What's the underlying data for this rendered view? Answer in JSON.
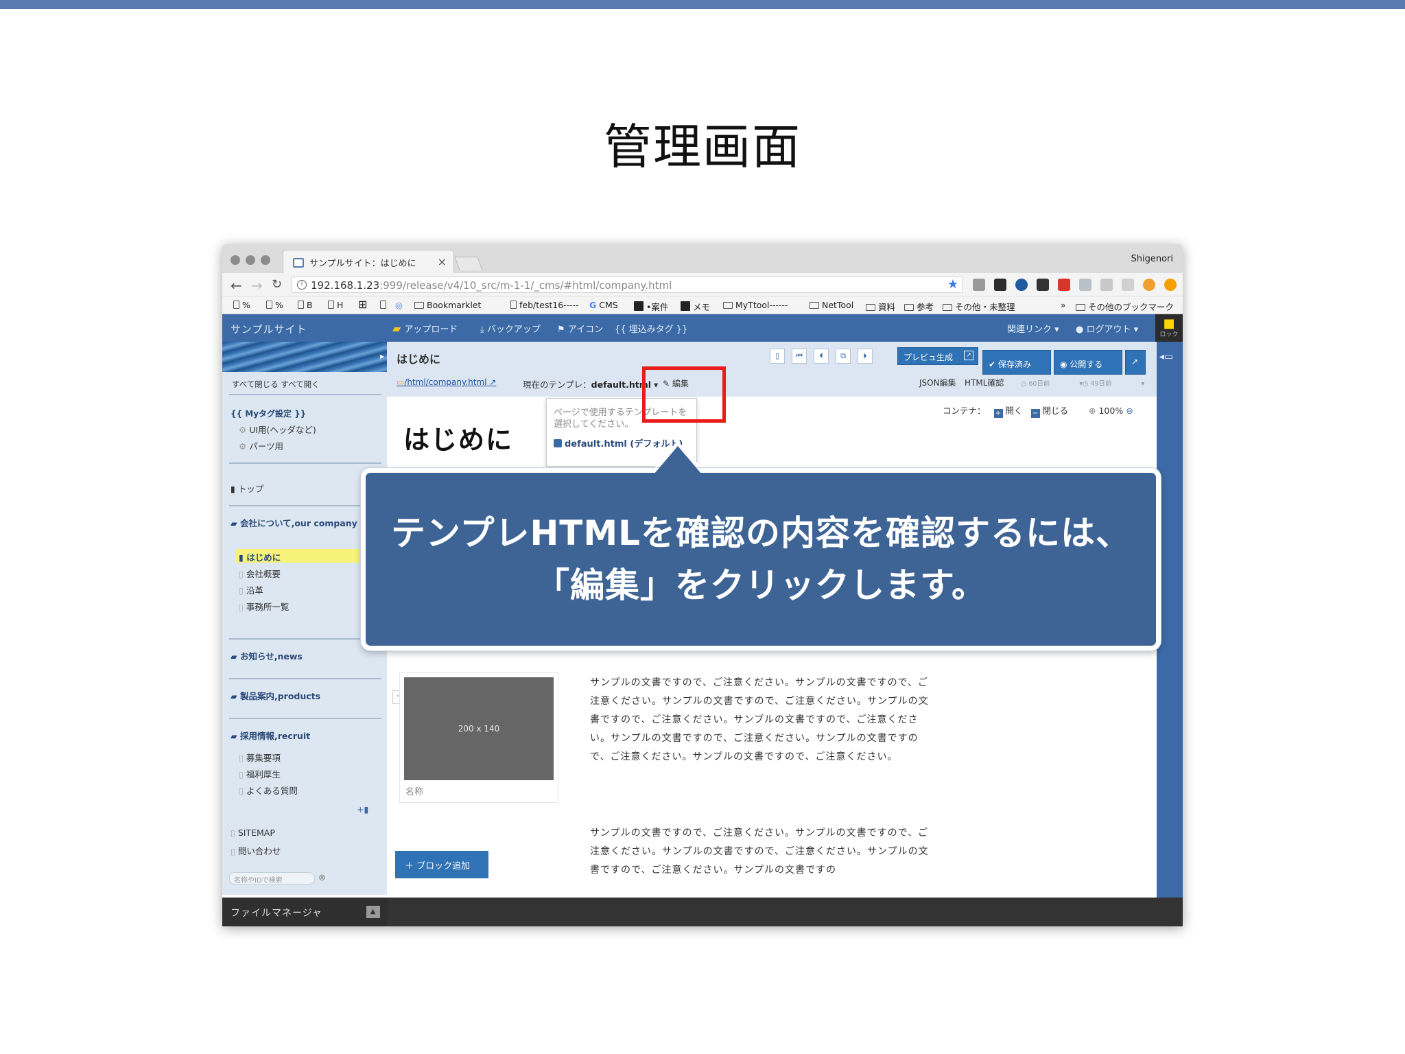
{
  "slide": {
    "title": "管理画面"
  },
  "browser": {
    "tab_title": "サンプルサイト：はじめに",
    "profile": "Shigenori",
    "url_host": "192.168.1.23",
    "url_rest": ":999/release/v4/10_src/m-1-1/_cms/#html/company.html",
    "bookmarks": [
      "%",
      "%",
      "B",
      "H",
      "Bookmarklet",
      "feb/test16-----",
      "CMS",
      "•案件",
      "メモ",
      "MyTtool------",
      "NetTool",
      "資料",
      "参考",
      "その他・未整理",
      "その他のブックマーク"
    ]
  },
  "cms": {
    "site_name": "サンプルサイト",
    "menu": {
      "upload": "アップロード",
      "backup": "バックアップ",
      "icon": "アイコン",
      "embed": "{{ 埋込みタグ }}",
      "related": "関連リンク ▾",
      "logout": "ログアウト ▾"
    },
    "lock_label": "ロック",
    "sidebar": {
      "toggle": "すべて閉じる  すべて開く",
      "mytag": "{{ Myタグ設定 }}",
      "ui": "UI用(ヘッダなど)",
      "parts": "パーツ用",
      "top": "トップ",
      "company": "会社について,our company",
      "intro": "はじめに",
      "overview": "会社概要",
      "history": "沿革",
      "offices": "事務所一覧",
      "news": "お知らせ,news",
      "products": "製品案内,products",
      "recruit": "採用情報,recruit",
      "jobs": "募集要項",
      "welfare": "福利厚生",
      "faq": "よくある質問",
      "sitemap": "SITEMAP",
      "contact": "問い合わせ",
      "search_placeholder": "名称やIDで検索",
      "file_manager": "ファイルマネージャ"
    },
    "page_title": "はじめに",
    "path": "/html/company.html",
    "template_label": "現在のテンプレ：",
    "template_name": "default.html",
    "edit": "編集",
    "preview_btn": "プレビュ生成",
    "saved_btn": "保存済み",
    "publish_btn": "公開する",
    "json_edit": "JSON編集",
    "html_check": "HTML確認",
    "time1": "60日前",
    "time2": "49日前",
    "container": "コンテナ：",
    "open": "開く",
    "close": "閉じる",
    "zoom": "100%",
    "content_heading": "はじめに",
    "popup_text": "ページで使用するテンプレートを選択してください。",
    "popup_option": "default.html (デフォルト)",
    "image_placeholder": "200 x 140",
    "image_caption": "名称",
    "paragraph1": "サンプルの文書ですので、ご注意ください。サンプルの文書ですので、ご注意ください。サンプルの文書ですので、ご注意ください。サンプルの文書ですので、ご注意ください。サンプルの文書ですので、ご注意ください。サンプルの文書ですので、ご注意ください。サンプルの文書ですので、ご注意ください。サンプルの文書ですので、ご注意ください。",
    "paragraph2": "サンプルの文書ですので、ご注意ください。サンプルの文書ですので、ご注意ください。サンプルの文書ですので、ご注意ください。サンプルの文書ですので、ご注意ください。サンプルの文書ですの",
    "add_block": "＋  ブロック追加"
  },
  "callout": {
    "line1": "テンプレHTMLを確認の内容を確認するには、",
    "line2": "「編集」をクリックします。"
  },
  "colors": {
    "cms_blue": "#3b6aa6",
    "highlight": "#e81c1c",
    "callout_bg": "#3e6496"
  }
}
